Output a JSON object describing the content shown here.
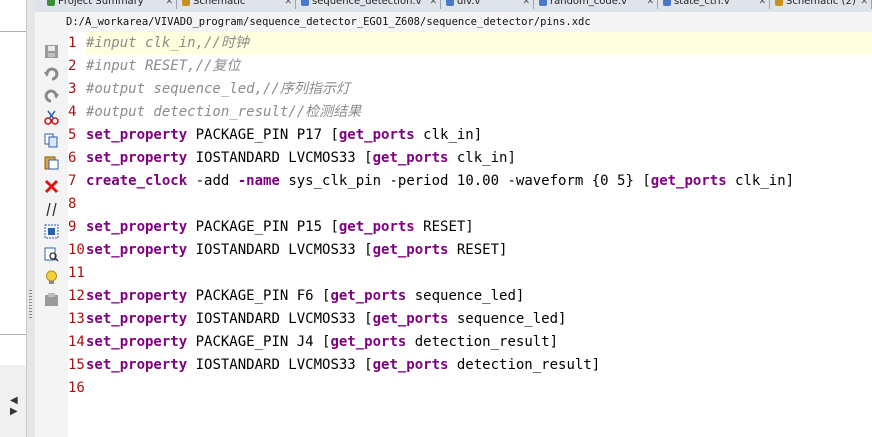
{
  "tabs": [
    {
      "label": "Project Summary",
      "color": "#3b8f3b"
    },
    {
      "label": "Schematic",
      "color": "#c89020"
    },
    {
      "label": "sequence_detection.v",
      "color": "#4a78c8"
    },
    {
      "label": "div.v",
      "color": "#4a78c8"
    },
    {
      "label": "random_code.v",
      "color": "#4a78c8"
    },
    {
      "label": "state_ctrl.v",
      "color": "#4a78c8"
    },
    {
      "label": "Schematic (2)",
      "color": "#c89020"
    }
  ],
  "file_path": "D:/A_workarea/VIVADO_program/sequence_detector_EGO1_Z608/sequence_detector/pins.xdc",
  "toolbar_icons": [
    "save-icon",
    "undo-icon",
    "redo-icon",
    "cut-icon",
    "copy-icon",
    "paste-icon",
    "delete-icon",
    "comment-toggle-icon",
    "select-all-icon",
    "find-icon",
    "hint-icon",
    "template-icon"
  ],
  "left_panel": {
    "scroll_arrows": "◀ ▶"
  },
  "editor": {
    "lines": [
      {
        "num": "1",
        "segments": [
          {
            "t": "#input clk_in,//时钟",
            "c": "cm"
          }
        ]
      },
      {
        "num": "2",
        "segments": [
          {
            "t": "#input RESET,//复位",
            "c": "cm"
          }
        ]
      },
      {
        "num": "3",
        "segments": [
          {
            "t": "#output sequence_led,//序列指示灯",
            "c": "cm"
          }
        ]
      },
      {
        "num": "4",
        "segments": [
          {
            "t": "#output detection_result//检测结果",
            "c": "cm"
          }
        ]
      },
      {
        "num": "5",
        "segments": [
          {
            "t": "set_property",
            "c": "kw"
          },
          {
            "t": " PACKAGE_PIN P17 [",
            "c": ""
          },
          {
            "t": "get_ports",
            "c": "kw"
          },
          {
            "t": " clk_in]",
            "c": ""
          }
        ]
      },
      {
        "num": "6",
        "segments": [
          {
            "t": "set_property",
            "c": "kw"
          },
          {
            "t": " IOSTANDARD LVCMOS33 [",
            "c": ""
          },
          {
            "t": "get_ports",
            "c": "kw"
          },
          {
            "t": " clk_in]",
            "c": ""
          }
        ]
      },
      {
        "num": "7",
        "segments": [
          {
            "t": "create_clock",
            "c": "kw"
          },
          {
            "t": " -add ",
            "c": ""
          },
          {
            "t": "-name",
            "c": "kw"
          },
          {
            "t": " sys_clk_pin -period 10.00 -waveform {0 5} [",
            "c": ""
          },
          {
            "t": "get_ports",
            "c": "kw"
          },
          {
            "t": " clk_in]",
            "c": ""
          }
        ]
      },
      {
        "num": "8",
        "segments": []
      },
      {
        "num": "9",
        "segments": [
          {
            "t": "set_property",
            "c": "kw"
          },
          {
            "t": " PACKAGE_PIN P15 [",
            "c": ""
          },
          {
            "t": "get_ports",
            "c": "kw"
          },
          {
            "t": " RESET]",
            "c": ""
          }
        ]
      },
      {
        "num": "10",
        "segments": [
          {
            "t": "set_property",
            "c": "kw"
          },
          {
            "t": " IOSTANDARD LVCMOS33 [",
            "c": ""
          },
          {
            "t": "get_ports",
            "c": "kw"
          },
          {
            "t": " RESET]",
            "c": ""
          }
        ]
      },
      {
        "num": "11",
        "segments": []
      },
      {
        "num": "12",
        "segments": [
          {
            "t": "set_property",
            "c": "kw"
          },
          {
            "t": " PACKAGE_PIN F6 [",
            "c": ""
          },
          {
            "t": "get_ports",
            "c": "kw"
          },
          {
            "t": " sequence_led]",
            "c": ""
          }
        ]
      },
      {
        "num": "13",
        "segments": [
          {
            "t": "set_property",
            "c": "kw"
          },
          {
            "t": " IOSTANDARD LVCMOS33 [",
            "c": ""
          },
          {
            "t": "get_ports",
            "c": "kw"
          },
          {
            "t": " sequence_led]",
            "c": ""
          }
        ]
      },
      {
        "num": "14",
        "segments": [
          {
            "t": "set_property",
            "c": "kw"
          },
          {
            "t": " PACKAGE_PIN J4 [",
            "c": ""
          },
          {
            "t": "get_ports",
            "c": "kw"
          },
          {
            "t": " detection_result]",
            "c": ""
          }
        ]
      },
      {
        "num": "15",
        "segments": [
          {
            "t": "set_property",
            "c": "kw"
          },
          {
            "t": " IOSTANDARD LVCMOS33 [",
            "c": ""
          },
          {
            "t": "get_ports",
            "c": "kw"
          },
          {
            "t": " detection_result]",
            "c": ""
          }
        ]
      },
      {
        "num": "16",
        "segments": []
      }
    ]
  },
  "colors": {
    "keyword": "#7f0080",
    "comment": "#8c8c8c",
    "line_number": "#aa1111",
    "current_line": "#ffffe0"
  }
}
